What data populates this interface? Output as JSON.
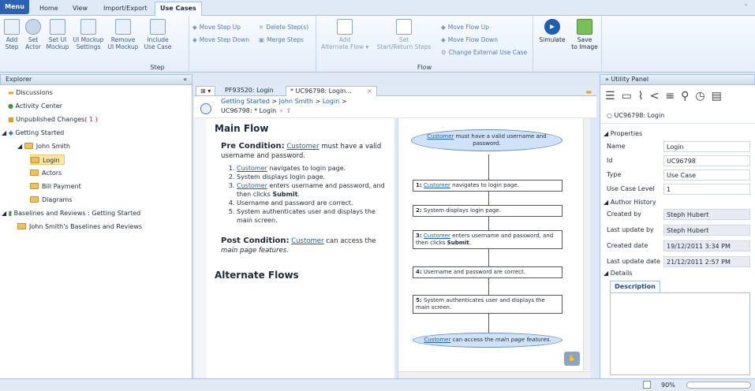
{
  "tabs": {
    "menu": "Menu",
    "home": "Home",
    "view": "View",
    "import": "Import/Export",
    "usecases": "Use Cases"
  },
  "ribbon": {
    "step_group": "Step",
    "flow_group": "Flow",
    "add_step": "Add\nStep",
    "set_actor": "Set\nActor",
    "set_mockup": "Set UI\nMockup",
    "mockup_settings": "UI Mockup\nSettings",
    "remove_mockup": "Remove\nUI Mockup",
    "include": "Include\nUse Case",
    "move_up": "Move Step Up",
    "move_down": "Move Step Down",
    "delete": "Delete Step(s)",
    "merge": "Merge Steps",
    "add_alt": "Add\nAlternate Flow ▾",
    "set_start": "Set\nStart/Return Steps",
    "flow_up": "Move Flow Up",
    "flow_down": "Move Flow Down",
    "change_ext": "Change External Use Case",
    "simulate": "Simulate",
    "save_image": "Save\nto Image"
  },
  "explorer": {
    "title": "Explorer",
    "collapse": "«",
    "items": [
      "Discussions",
      "Activity Center",
      "Unpublished Changes",
      "( 1 )",
      "Getting Started",
      "John Smith",
      "Login",
      "Actors",
      "Bill Payment",
      "Diagrams",
      "Baselines and Reviews : Getting Started",
      "John Smith's Baselines and Reviews"
    ]
  },
  "doctabs": {
    "t1": "PF93520: Login",
    "t2": "* UC96798: Login...",
    "close": "×"
  },
  "breadcrumb": {
    "a": "Getting Started",
    "b": "John Smith",
    "c": "Login",
    "sep": ">"
  },
  "doc_title": "UC96798: * Login",
  "text": {
    "main_flow": "Main Flow",
    "pre_label": "Pre Condition:",
    "customer": "Customer",
    "pre_rest": " must have a valid username and password.",
    "steps": [
      "navigates to login page.",
      "System displays login page.",
      "enters username and password, and then clicks ",
      "Submit",
      "Username and password are correct.",
      "System authenticates user and displays the main screen."
    ],
    "post_label": "Post Condition:",
    "post_rest": " can access the",
    "post_italic": "main page features",
    "alt": "Alternate Flows"
  },
  "flow": {
    "start_rest": " must have a valid username and password.",
    "b1": "navigates to login page.",
    "b2": "System displays login page.",
    "b3": "enters username and password, and then clicks ",
    "b3b": "Submit",
    "b4": "Username and password are correct.",
    "b5": "System authenticates user and displays the main screen.",
    "end_rest": " can access the ",
    "end_italic": "main page features."
  },
  "util": {
    "title": "Utility Panel",
    "collapse": "»",
    "item": "UC96798: Login",
    "properties": "Properties",
    "author": "Author History",
    "details": "Details",
    "description": "Description",
    "rows": [
      [
        "Name",
        "Login"
      ],
      [
        "Id",
        "UC96798"
      ],
      [
        "Type",
        "Use Case"
      ],
      [
        "Use Case Level",
        "1"
      ]
    ],
    "arows": [
      [
        "Created by",
        "Steph Hubert"
      ],
      [
        "Last update by",
        "Steph Hubert"
      ],
      [
        "Created date",
        "19/12/2011 3:34 PM"
      ],
      [
        "Last update date",
        "21/12/2011 2:57 PM"
      ]
    ]
  },
  "status": {
    "zoom": "90%"
  }
}
